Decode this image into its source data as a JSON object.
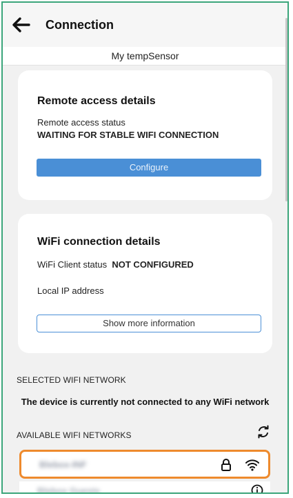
{
  "app": {
    "title": "Connection"
  },
  "device": {
    "name": "My tempSensor"
  },
  "remote_card": {
    "heading": "Remote access details",
    "status_label": "Remote access status",
    "status_value": "WAITING FOR STABLE WIFI CONNECTION",
    "configure_label": "Configure"
  },
  "wifi_card": {
    "heading": "WiFi connection details",
    "client_status_label": "WiFi Client status",
    "client_status_value": "NOT CONFIGURED",
    "ip_label": "Local IP address",
    "more_label": "Show more information"
  },
  "selected_network": {
    "section_label": "SELECTED WIFI NETWORK",
    "message": "The device is currently not connected to any WiFi network"
  },
  "available_networks": {
    "section_label": "AVAILABLE WIFI NETWORKS",
    "refresh_icon": "refresh-icon",
    "items": [
      {
        "name": "Blebox-INF",
        "secured": true,
        "icon": "wifi-signal-icon"
      },
      {
        "name": "Blebox Guests",
        "secured": false,
        "icon": "info-icon"
      }
    ]
  },
  "colors": {
    "accent": "#4a8fd6",
    "highlight_border": "#ee8a2d",
    "frame_border": "#3aa57a"
  }
}
